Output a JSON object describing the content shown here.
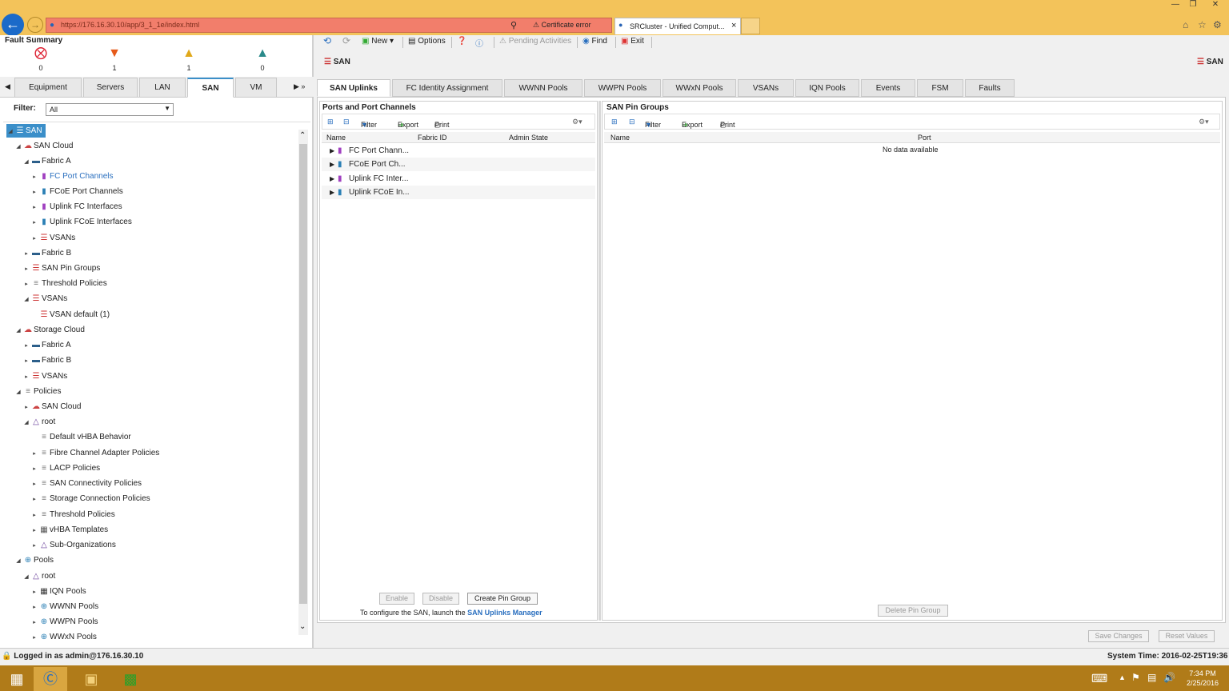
{
  "browser": {
    "url": "https://176.16.30.10/app/3_1_1e/index.html",
    "cert_error": "Certificate error",
    "tab_title": "SRCluster - Unified Comput..."
  },
  "fault_summary": {
    "title": "Fault Summary",
    "counts": [
      "0",
      "1",
      "1",
      "0"
    ]
  },
  "nav_tabs": [
    "Equipment",
    "Servers",
    "LAN",
    "SAN",
    "VM"
  ],
  "filter": {
    "label": "Filter:",
    "value": "All"
  },
  "tree": [
    {
      "label": "SAN"
    },
    {
      "label": "SAN Cloud"
    },
    {
      "label": "Fabric A"
    },
    {
      "label": "FC Port Channels"
    },
    {
      "label": "FCoE Port Channels"
    },
    {
      "label": "Uplink FC Interfaces"
    },
    {
      "label": "Uplink FCoE Interfaces"
    },
    {
      "label": "VSANs"
    },
    {
      "label": "Fabric B"
    },
    {
      "label": "SAN Pin Groups"
    },
    {
      "label": "Threshold Policies"
    },
    {
      "label": "VSANs"
    },
    {
      "label": "VSAN default (1)"
    },
    {
      "label": "Storage Cloud"
    },
    {
      "label": "Fabric A"
    },
    {
      "label": "Fabric B"
    },
    {
      "label": "VSANs"
    },
    {
      "label": "Policies"
    },
    {
      "label": "SAN Cloud"
    },
    {
      "label": "root"
    },
    {
      "label": "Default vHBA Behavior"
    },
    {
      "label": "Fibre Channel Adapter Policies"
    },
    {
      "label": "LACP Policies"
    },
    {
      "label": "SAN Connectivity Policies"
    },
    {
      "label": "Storage Connection Policies"
    },
    {
      "label": "Threshold Policies"
    },
    {
      "label": "vHBA Templates"
    },
    {
      "label": "Sub-Organizations"
    },
    {
      "label": "Pools"
    },
    {
      "label": "root"
    },
    {
      "label": "IQN Pools"
    },
    {
      "label": "WWNN Pools"
    },
    {
      "label": "WWPN Pools"
    },
    {
      "label": "WWxN Pools"
    }
  ],
  "toolbar": {
    "new": "New",
    "options": "Options",
    "pending": "Pending Activities",
    "find": "Find",
    "exit": "Exit"
  },
  "section_title": "SAN",
  "content_tabs": [
    "SAN Uplinks",
    "FC Identity Assignment",
    "WWNN Pools",
    "WWPN Pools",
    "WWxN Pools",
    "VSANs",
    "IQN Pools",
    "Events",
    "FSM",
    "Faults"
  ],
  "ports_panel": {
    "title": "Ports and Port Channels",
    "filter": "Filter",
    "export": "Export",
    "print": "Print",
    "columns": [
      "Name",
      "Fabric ID",
      "Admin State"
    ],
    "rows": [
      "FC Port Chann...",
      "FCoE Port Ch...",
      "Uplink FC Inter...",
      "Uplink FCoE In..."
    ],
    "buttons": {
      "enable": "Enable",
      "disable": "Disable",
      "create": "Create Pin Group"
    },
    "hint": "To configure the SAN, launch the",
    "hint_link": "SAN Uplinks Manager"
  },
  "pin_panel": {
    "title": "SAN Pin Groups",
    "filter": "Filter",
    "export": "Export",
    "print": "Print",
    "columns": [
      "Name",
      "Port"
    ],
    "empty": "No data available",
    "delete": "Delete Pin Group"
  },
  "footer": {
    "save": "Save Changes",
    "reset": "Reset Values"
  },
  "status": {
    "logged": "Logged in as admin@176.16.30.10",
    "system_time": "System Time: 2016-02-25T19:36"
  },
  "clock": {
    "time": "7:34 PM",
    "date": "2/25/2016"
  }
}
